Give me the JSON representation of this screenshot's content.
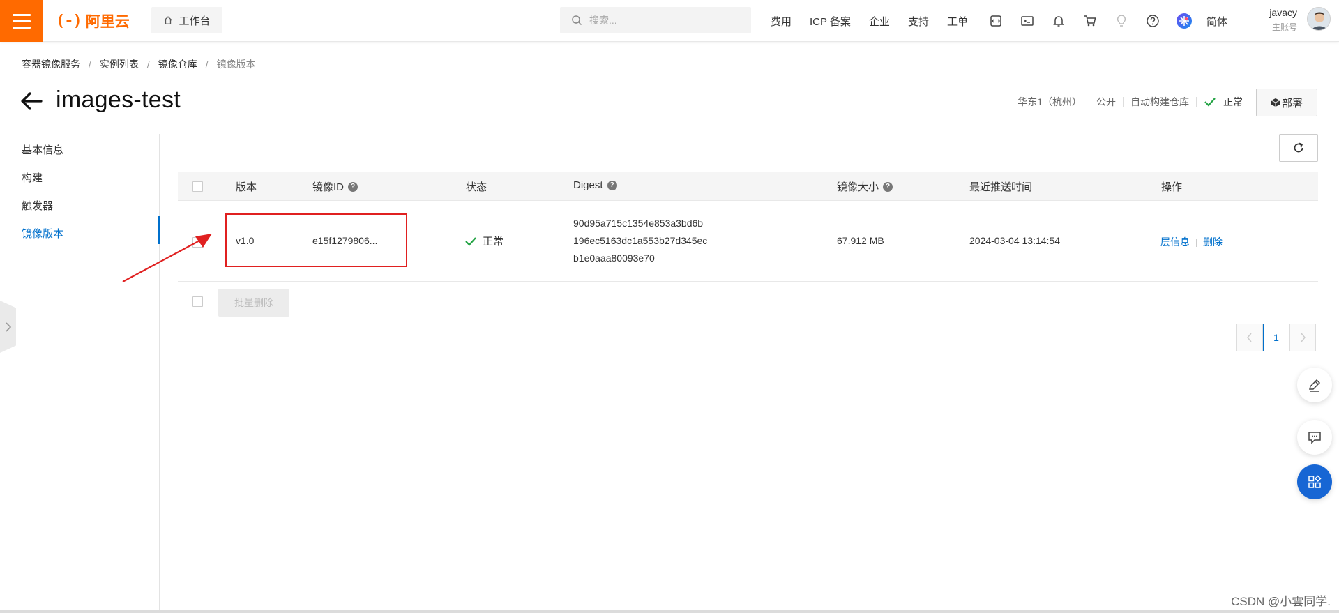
{
  "topbar": {
    "logo_mark": "(-)",
    "logo_text": "阿里云",
    "workbench_label": "工作台",
    "search_placeholder": "搜索...",
    "nav_links": [
      "费用",
      "ICP 备案",
      "企业",
      "支持",
      "工单"
    ],
    "nav_icons": [
      "code-editor-icon",
      "terminal-icon",
      "bell-icon",
      "cart-icon",
      "lightbulb-icon",
      "help-icon",
      "ai-assistant-icon"
    ],
    "language": "简体",
    "user_name": "javacy",
    "user_role": "主账号"
  },
  "breadcrumb": [
    "容器镜像服务",
    "实例列表",
    "镜像仓库",
    "镜像版本"
  ],
  "page": {
    "title": "images-test",
    "region": "华东1（杭州）",
    "visibility": "公开",
    "repo_type": "自动构建仓库",
    "status": "正常",
    "deploy_label": "部署"
  },
  "sidebar": {
    "items": [
      {
        "label": "基本信息",
        "active": false
      },
      {
        "label": "构建",
        "active": false
      },
      {
        "label": "触发器",
        "active": false
      },
      {
        "label": "镜像版本",
        "active": true
      }
    ]
  },
  "table": {
    "headers": {
      "version": "版本",
      "image_id": "镜像ID",
      "status": "状态",
      "digest": "Digest",
      "size": "镜像大小",
      "pushed": "最近推送时间",
      "actions": "操作"
    },
    "rows": [
      {
        "version": "v1.0",
        "image_id": "e15f1279806...",
        "status": "正常",
        "digest_lines": [
          "90d95a715c1354e853a3bd6b",
          "196ec5163dc1a553b27d345ec",
          "b1e0aaa80093e70"
        ],
        "size": "67.912 MB",
        "pushed": "2024-03-04 13:14:54",
        "action_layers": "层信息",
        "action_delete": "删除"
      }
    ],
    "batch_delete_label": "批量删除"
  },
  "pagination": {
    "current_page": "1",
    "prev": "<",
    "next": ">"
  },
  "watermark": "CSDN @小雲同学.",
  "colors": {
    "brand_orange": "#ff6a00",
    "link_blue": "#0070cc",
    "status_green": "#23a344",
    "annotation_red": "#e02020"
  }
}
